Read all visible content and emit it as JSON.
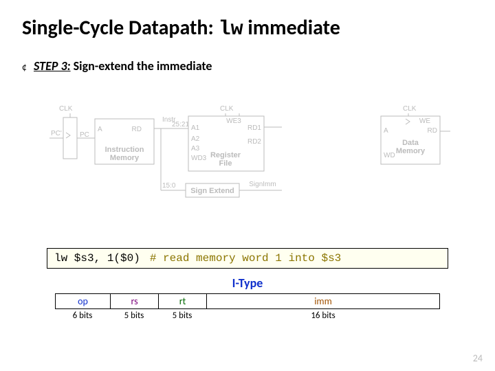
{
  "title": {
    "pre": "Single-Cycle Datapath: ",
    "kw": "lw",
    "post": " immediate"
  },
  "step": {
    "dot": "¢",
    "label_ital": "STEP 3:",
    "label_rest": " Sign-extend the immediate"
  },
  "diagram": {
    "clk": "CLK",
    "pc": "PC",
    "pcp": "PC'",
    "a": "A",
    "rd": "RD",
    "imem": "Instruction",
    "imem2": "Memory",
    "instr": "Instr",
    "slice2521": "25:21",
    "slice150": "15:0",
    "a1": "A1",
    "a2": "A2",
    "a3": "A3",
    "wd3": "WD3",
    "we3": "WE3",
    "rd1": "RD1",
    "rd2": "RD2",
    "regfile": "Register",
    "regfile2": "File",
    "signext": "Sign Extend",
    "signimm": "SignImm",
    "we": "WE",
    "dmem": "Data",
    "dmem2": "Memory",
    "wd": "WD"
  },
  "code": {
    "instr": "lw $s3, 1($0)",
    "comment": "# read memory word 1 into $s3"
  },
  "itype": {
    "label": "I-Type",
    "fields": {
      "op": "op",
      "rs": "rs",
      "rt": "rt",
      "imm": "imm"
    },
    "bits": {
      "op": "6 bits",
      "rs": "5 bits",
      "rt": "5 bits",
      "imm": "16 bits"
    }
  },
  "pagenum": "24"
}
